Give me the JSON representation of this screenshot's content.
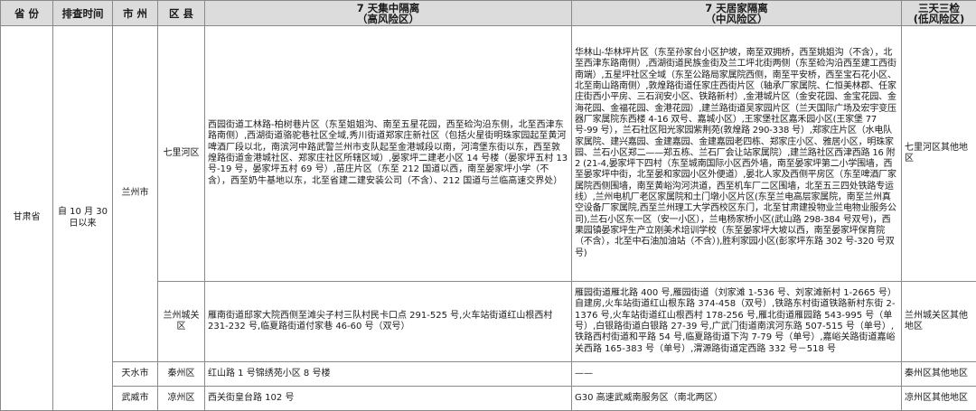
{
  "header": {
    "province": "省 份",
    "time": "排查时间",
    "city": "市 州",
    "district": "区 县",
    "high_risk": "7 天集中隔离",
    "high_risk_sub": "（高风险区）",
    "mid_risk": "7 天居家隔离",
    "mid_risk_sub": "（中风险区）",
    "low_risk": "三天三检",
    "low_risk_sub": "(低风险区)"
  },
  "province": "甘肃省",
  "time": "自 10 月 30 日以来",
  "rows": [
    {
      "city": "兰州市",
      "district": "七里河区",
      "high": "西园街道工林路-柏树巷片区（东至姐姐沟、南至五星花园，西至硷沟沿东侧，北至西津东路南侧）,西湖街道骆驼巷社区全域,秀川街道郑家庄新社区（包括火星街明珠家园起至黄河啤酒厂段以北，南滨河中路武警兰州市支队起至金港城段以南，河湾堡东街以东，西至敦煌路街道金港城社区、郑家庄社区所辖区域）,晏家坪二建老小区 14 号楼（晏家坪五村 13 号-19 号，晏家坪五村 69 号）,苗庄片区（东至 212 国道以西，南至晏家坪小学（不含），西至奶牛基地以东，北至省建二建安装公司（不含）、212 国道与兰临高速交界处）",
      "mid": "华林山-华林坪片区（东至孙家台小区护坡，南至双拥桥，西至姚姐沟（不含），北至西津东路南侧）,西湖街道民族金街及兰工坪北街两侧（东至硷沟沿西至建工西街南端）,五星坪社区全域（东至公路局家属院西侧，南至平安桥，西至宝石花小区、北至南山路南侧）,敦煌路街道任家庄西街片区（轴承厂家属院、仁恒美林郡、任家庄街西小平房、三石润安小区、铁路新村）,金港城片区（金安花园、金宝花园、金海花园、金福花园、金港花园）,建兰路街道吴家园片区（兰天国际广场及宏宇变压器厂家属院东西楼 4-16 双号、嘉城小区）,王家堡社区嘉禾园小区(王家堡 77 号-99 号），兰石社区阳光家园紫荆苑(敦煌路 290-338 号）,郑家庄片区（水电队家属院、建兴嘉园、金建嘉园、金建嘉园老四栋、郑家庄小区、雅居小区，明珠家园、兰石小区郑二——郑五栋、兰石厂会让站家属院）,建兰路社区西津西路 16 附 2 (21-4,晏家坪下四村（东至城南国际小区西外墙，南至晏家坪第二小学围墙，西至晏家坪中街，北至晏和家园小区外便道）,晏北人家及西侧平房区（东至啤酒厂家属院西侧围墙，南至黄峪沟河洪道，西至机车厂二区围墙，北至五三四处铁路专运线）,兰州电机厂老区家属院和土门墩小区片区(东至兰电高层家属院，南至兰州真空设备厂家属院,西至兰州理工大学西校区东门，北至甘肃建投物业兰电物业服务公司),兰石小区东一区（安一小区），兰电杨家桥小区(武山路 298-384 号双号)，西果园镇晏家坪生产立刚美术培训学校（东至晏家坪大坡以西，南至晏家坪保育院（不含），北至中石油加油站（不含）),胜利家园小区(彭家坪东路 302 号-320 号双号)",
      "low": "七里河区其他地区"
    },
    {
      "district": "兰州城关区",
      "high": "雁南街道邸家大院西侧至滩尖子村三队村民卡口点 291-525 号,火车站街道红山根西村 231-232 号,临夏路街道付家巷 46-60 号（双号）",
      "mid": "雁园街道雁北路 400 号,雁园街道（刘家滩 1-536 号、刘家滩新村 1-2665 号）自建房,火车站街道红山根东路 374-458（双号）,铁路东村街道铁路新村东街 2-1376 号,火车站街道红山根西村 178-256 号,雁北街道雁园路 543-995 号（单号）,白银路街道白银路 27-39 号,广武门街道南滨河东路 507-515 号（单号）,铁路西村街道和平路 54 号,临夏路街道下沟 7-79 号（单号）,嘉峪关路街道嘉峪关西路 165-383 号（单号）,渭源路街道定西路 332 号－518 号",
      "low": "兰州城关区其他地区"
    },
    {
      "city": "天水市",
      "district": "秦州区",
      "high": "红山路 1 号锦绣苑小区 8 号楼",
      "mid": "——",
      "low": "秦州区其他地区"
    },
    {
      "city": "武威市",
      "district": "凉州区",
      "high": "西关街皇台路 102 号",
      "mid": "G30 高速武威南服务区（南北两区）",
      "low": "凉州区其他地区"
    }
  ]
}
